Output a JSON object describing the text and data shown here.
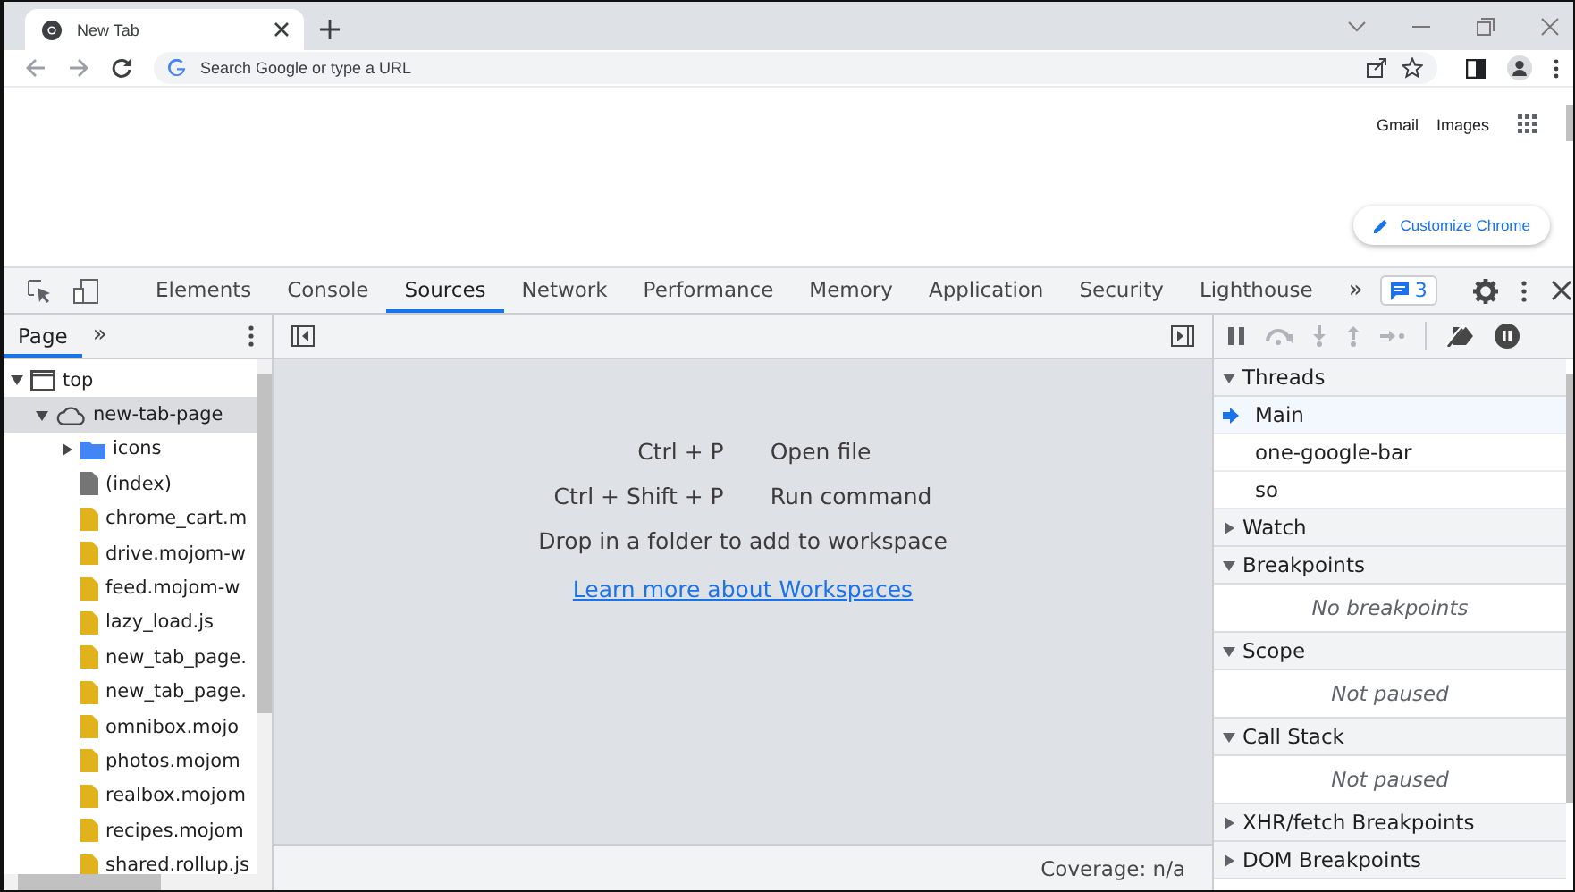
{
  "browser": {
    "tab": {
      "title": "New Tab"
    },
    "address_bar": {
      "placeholder": "Search Google or type a URL"
    },
    "page": {
      "links": [
        "Gmail",
        "Images"
      ],
      "customize_button": "Customize Chrome"
    }
  },
  "devtools": {
    "tabs": [
      {
        "label": "Elements",
        "selected": false
      },
      {
        "label": "Console",
        "selected": false
      },
      {
        "label": "Sources",
        "selected": true
      },
      {
        "label": "Network",
        "selected": false
      },
      {
        "label": "Performance",
        "selected": false
      },
      {
        "label": "Memory",
        "selected": false
      },
      {
        "label": "Application",
        "selected": false
      },
      {
        "label": "Security",
        "selected": false
      },
      {
        "label": "Lighthouse",
        "selected": false
      }
    ],
    "more_tabs": "»",
    "issues_badge": "3",
    "navigator": {
      "tabs": [
        {
          "label": "Page",
          "selected": true
        }
      ],
      "more_tabs": "»",
      "tree": [
        {
          "label": "top",
          "kind": "frame",
          "expanded": true,
          "selected": false,
          "children": [
            {
              "label": "new-tab-page",
              "kind": "origin",
              "expanded": true,
              "selected": true,
              "children": [
                {
                  "label": "icons",
                  "kind": "folder",
                  "expanded": false,
                  "selected": false
                },
                {
                  "label": "(index)",
                  "kind": "document",
                  "selected": false
                },
                {
                  "label": "chrome_cart.m",
                  "kind": "script",
                  "selected": false
                },
                {
                  "label": "drive.mojom-w",
                  "kind": "script",
                  "selected": false
                },
                {
                  "label": "feed.mojom-w",
                  "kind": "script",
                  "selected": false
                },
                {
                  "label": "lazy_load.js",
                  "kind": "script",
                  "selected": false
                },
                {
                  "label": "new_tab_page.",
                  "kind": "script",
                  "selected": false
                },
                {
                  "label": "new_tab_page.",
                  "kind": "script",
                  "selected": false
                },
                {
                  "label": "omnibox.mojo",
                  "kind": "script",
                  "selected": false
                },
                {
                  "label": "photos.mojom",
                  "kind": "script",
                  "selected": false
                },
                {
                  "label": "realbox.mojom",
                  "kind": "script",
                  "selected": false
                },
                {
                  "label": "recipes.mojom",
                  "kind": "script",
                  "selected": false
                },
                {
                  "label": "shared.rollup.js",
                  "kind": "script",
                  "selected": false
                }
              ]
            }
          ]
        }
      ]
    },
    "editor": {
      "shortcuts": [
        {
          "keys": "Ctrl + P",
          "action": "Open file"
        },
        {
          "keys": "Ctrl + Shift + P",
          "action": "Run command"
        }
      ],
      "hint": "Drop in a folder to add to workspace",
      "link": "Learn more about Workspaces",
      "status": "Coverage: n/a"
    },
    "debugger": {
      "sections": [
        {
          "title": "Threads",
          "kind": "list",
          "expanded": true,
          "items": [
            {
              "label": "Main",
              "selected": true
            },
            {
              "label": "one-google-bar",
              "selected": false
            },
            {
              "label": "so",
              "selected": false
            }
          ]
        },
        {
          "title": "Watch",
          "expanded": false
        },
        {
          "title": "Breakpoints",
          "kind": "message",
          "expanded": true,
          "message": "No breakpoints"
        },
        {
          "title": "Scope",
          "kind": "message",
          "expanded": true,
          "message": "Not paused"
        },
        {
          "title": "Call Stack",
          "kind": "message",
          "expanded": true,
          "message": "Not paused"
        },
        {
          "title": "XHR/fetch Breakpoints",
          "expanded": false
        },
        {
          "title": "DOM Breakpoints",
          "expanded": false
        }
      ]
    }
  }
}
